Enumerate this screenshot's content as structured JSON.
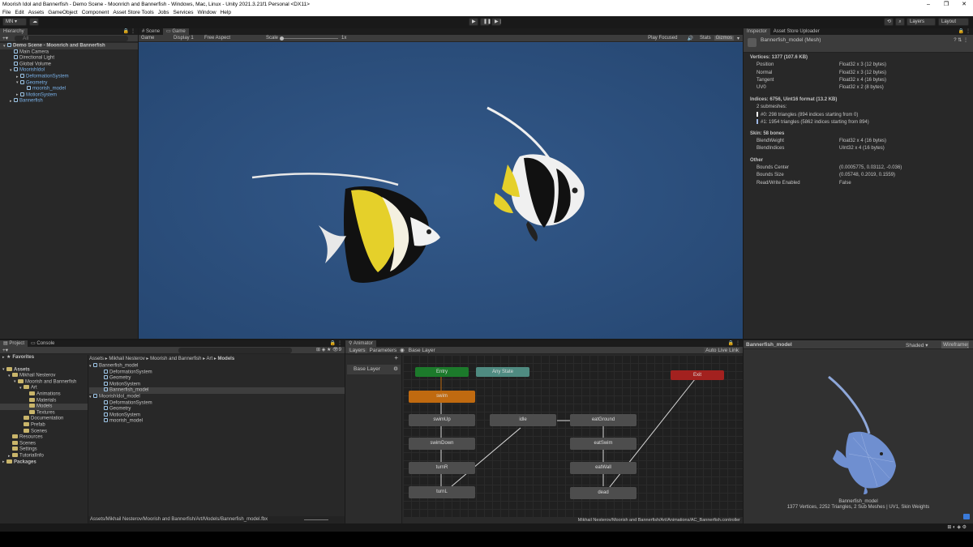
{
  "window": {
    "title": "Moorish Idol and Bannerfish - Demo Scene - Moonrich and Bannerfish - Windows, Mac, Linux - Unity 2021.3.21f1 Personal <DX11>",
    "controls": [
      "–",
      "❐",
      "✕"
    ]
  },
  "menu": [
    "File",
    "Edit",
    "Assets",
    "GameObject",
    "Component",
    "Asset Store Tools",
    "Jobs",
    "Services",
    "Window",
    "Help"
  ],
  "toolbar": {
    "account": "MN ▾",
    "layers": "Layers",
    "layout": "Layout"
  },
  "hierarchy": {
    "tab": "Hierarchy",
    "search_placeholder": "All",
    "items": [
      {
        "label": "Demo Scene - Moonrich and Bannerfish",
        "indent": 0,
        "bold": true,
        "arrow": "▾"
      },
      {
        "label": "Main Camera",
        "indent": 1
      },
      {
        "label": "Directional Light",
        "indent": 1
      },
      {
        "label": "Global Volume",
        "indent": 1
      },
      {
        "label": "MoorishIdol",
        "indent": 1,
        "blue": true,
        "arrow": "▾"
      },
      {
        "label": "DeformationSystem",
        "indent": 2,
        "blue": true,
        "arrow": "▸"
      },
      {
        "label": "Geometry",
        "indent": 2,
        "blue": true,
        "arrow": "▾"
      },
      {
        "label": "moorish_model",
        "indent": 3,
        "blue": true
      },
      {
        "label": "MotionSystem",
        "indent": 2,
        "blue": true,
        "arrow": "▸"
      },
      {
        "label": "Bannerfish",
        "indent": 1,
        "blue": true,
        "arrow": "▸"
      }
    ]
  },
  "game": {
    "tabs": [
      "Scene",
      "Game"
    ],
    "display": "Game",
    "display_num": "Display 1",
    "aspect": "Free Aspect",
    "scale_label": "Scale",
    "scale_value": "1x",
    "play_focused": "Play Focused",
    "stats": "Stats",
    "gizmos": "Gizmos"
  },
  "inspector": {
    "tabs": [
      "Inspector",
      "Asset Store Uploader"
    ],
    "object": "Bannerfish_model (Mesh)",
    "vertices_header": "Vertices: 1377 (107.6 KB)",
    "vertex_attrs": [
      [
        "Position",
        "Float32 x 3 (12 bytes)"
      ],
      [
        "Normal",
        "Float32 x 3 (12 bytes)"
      ],
      [
        "Tangent",
        "Float32 x 4 (16 bytes)"
      ],
      [
        "UV0",
        "Float32 x 2 (8 bytes)"
      ]
    ],
    "indices_header": "Indices: 6756, Uint16 format (13.2 KB)",
    "submeshes_label": "2 submeshes:",
    "submeshes": [
      "#0: 298 triangles (894 indices starting from 0)",
      "#1: 1954 triangles (5862 indices starting from 894)"
    ],
    "skin_header": "Skin: 58 bones",
    "skin_attrs": [
      [
        "BlendWeight",
        "Float32 x 4 (16 bytes)"
      ],
      [
        "BlendIndices",
        "UInt32 x 4 (16 bytes)"
      ]
    ],
    "other_header": "Other",
    "other_attrs": [
      [
        "Bounds Center",
        "(0.0005775, 0.03112, -0.036)"
      ],
      [
        "Bounds Size",
        "(0.05748, 0.2019, 0.1559)"
      ],
      [
        "Read/Write Enabled",
        "False"
      ]
    ]
  },
  "project": {
    "tabs": [
      "Project",
      "Console"
    ],
    "tree": [
      {
        "label": "Favorites",
        "indent": 0,
        "bold": true,
        "arrow": "▸"
      },
      {
        "label": "Assets",
        "indent": 0,
        "bold": true,
        "arrow": "▾",
        "gap": true
      },
      {
        "label": "Mikhail Nesterov",
        "indent": 1,
        "arrow": "▾"
      },
      {
        "label": "Moorish and Bannerfish",
        "indent": 2,
        "arrow": "▾"
      },
      {
        "label": "Art",
        "indent": 3,
        "arrow": "▾"
      },
      {
        "label": "Animations",
        "indent": 4
      },
      {
        "label": "Materials",
        "indent": 4
      },
      {
        "label": "Models",
        "indent": 4,
        "selected": true
      },
      {
        "label": "Textures",
        "indent": 4
      },
      {
        "label": "Documentation",
        "indent": 3
      },
      {
        "label": "Prefab",
        "indent": 3
      },
      {
        "label": "Scenes",
        "indent": 3
      },
      {
        "label": "Resources",
        "indent": 1
      },
      {
        "label": "Scenes",
        "indent": 1
      },
      {
        "label": "Settings",
        "indent": 1
      },
      {
        "label": "TutorialInfo",
        "indent": 1,
        "arrow": "▸"
      },
      {
        "label": "Packages",
        "indent": 0,
        "bold": true,
        "arrow": "▸"
      }
    ],
    "breadcrumb": [
      "Assets",
      "Mikhail Nesterov",
      "Moorish and Bannerfish",
      "Art",
      "Models"
    ],
    "files": [
      {
        "label": "Bannerfish_model",
        "indent": 0,
        "arrow": "▾"
      },
      {
        "label": "DeformationSystem",
        "indent": 1
      },
      {
        "label": "Geometry",
        "indent": 1
      },
      {
        "label": "MotionSystem",
        "indent": 1
      },
      {
        "label": "Bannerfish_model",
        "indent": 1,
        "selected": true
      },
      {
        "label": "MoorishIdol_model",
        "indent": 0,
        "arrow": "▾"
      },
      {
        "label": "DeformationSystem",
        "indent": 1
      },
      {
        "label": "Geometry",
        "indent": 1
      },
      {
        "label": "MotionSystem",
        "indent": 1
      },
      {
        "label": "moorish_model",
        "indent": 1
      }
    ],
    "path": "Assets/Mikhail Nesterov/Moorish and Bannerfish/Art/Models/Bannerfish_model.fbx",
    "hidden_count": "9"
  },
  "animator": {
    "tab": "Animator",
    "layers_tab": "Layers",
    "params_tab": "Parameters",
    "breadcrumb": "Base Layer",
    "layer_name": "Base Layer",
    "auto_live": "Auto Live Link",
    "path": "Mikhail Nesterov/Moorish and Bannerfish/Art/Animations/AC_Bannerfish.controller",
    "nodes": {
      "entry": "Entry",
      "any": "Any State",
      "exit": "Exit",
      "swim": "swim",
      "swimUp": "swimUp",
      "swimDown": "swimDown",
      "turnR": "turnR",
      "turnL": "turnL",
      "idle": "idle",
      "eatGround": "eatGround",
      "eatSwim": "eatSwim",
      "eatWall": "eatWall",
      "dead": "dead"
    }
  },
  "preview": {
    "title": "Bannerfish_model",
    "shaded": "Shaded",
    "wireframe": "Wireframe",
    "name": "Bannerfish_model",
    "stats": "1377 Vertices, 2252 Triangles, 2 Sub Meshes | UV1, Skin Weights"
  },
  "colors": {
    "entry": "#1c7a2b",
    "any": "#4f8b81",
    "exit": "#a3211f",
    "default_state": "#c06a10",
    "scene_bg": "#2c4f7e"
  }
}
